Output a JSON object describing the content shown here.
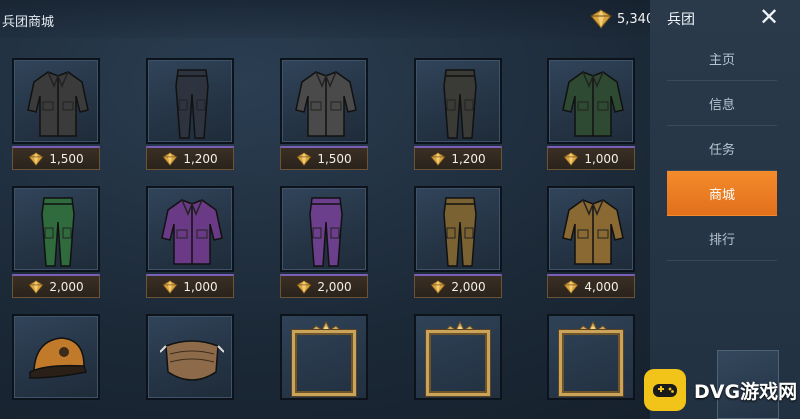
{
  "header": {
    "title": "兵团商城",
    "currency_amount": "5,340",
    "currency_icon": "diamond-coin-icon"
  },
  "sidepanel": {
    "title": "兵团",
    "close_glyph": "✕",
    "nav": [
      {
        "label": "主页",
        "active": false
      },
      {
        "label": "信息",
        "active": false
      },
      {
        "label": "任务",
        "active": false
      },
      {
        "label": "商城",
        "active": true
      },
      {
        "label": "排行",
        "active": false
      }
    ]
  },
  "colors": {
    "accent_orange": "#f38b2b",
    "price_border_purple": "#7a5fb8",
    "gold_frame": "#c9a45a",
    "watermark_yellow": "#f2c319"
  },
  "items": [
    {
      "kind": "jacket",
      "color": "#3b3b3b",
      "price": "1,500"
    },
    {
      "kind": "pants",
      "color": "#2e3340",
      "price": "1,200"
    },
    {
      "kind": "jacket",
      "color": "#4a4a4a",
      "price": "1,500"
    },
    {
      "kind": "pants",
      "color": "#3a3a36",
      "price": "1,200"
    },
    {
      "kind": "jacket",
      "color": "#2f4a33",
      "price": "1,000"
    },
    {
      "kind": "pants",
      "color": "#2f6b3d",
      "price": "2,000"
    },
    {
      "kind": "jacket",
      "color": "#6a3a86",
      "price": "1,000"
    },
    {
      "kind": "pants",
      "color": "#6b3f8c",
      "price": "2,000"
    },
    {
      "kind": "pants",
      "color": "#7a6232",
      "price": "2,000"
    },
    {
      "kind": "jacket",
      "color": "#8a6a32",
      "price": "4,000"
    },
    {
      "kind": "cap",
      "color": "#c07a2a",
      "price": ""
    },
    {
      "kind": "mask",
      "color": "#8c6a4a",
      "price": ""
    },
    {
      "kind": "gold-frame",
      "color": "#c9a45a",
      "price": ""
    },
    {
      "kind": "gold-frame",
      "color": "#c9a45a",
      "price": ""
    },
    {
      "kind": "gold-frame",
      "color": "#c9a45a",
      "price": ""
    }
  ],
  "watermark": {
    "text": "DVG游戏网"
  }
}
